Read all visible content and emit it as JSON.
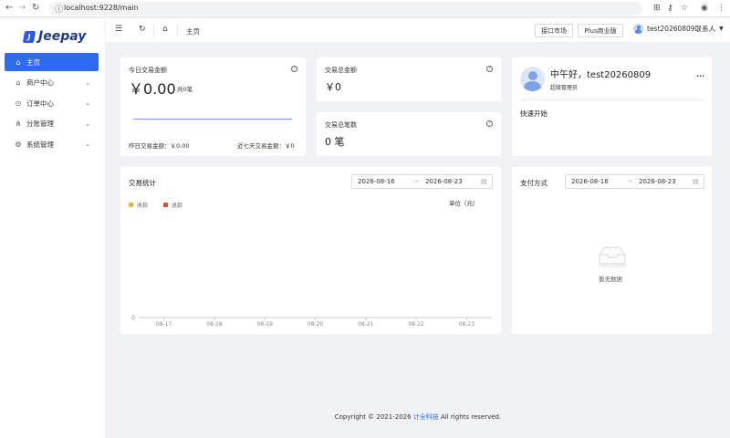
{
  "browser": {
    "url": "localhost:9228/main"
  },
  "brand": {
    "logo_letter": "J",
    "name": "Jeepay",
    "color": "#2f59d9"
  },
  "sidebar": {
    "items": [
      {
        "label": "主页",
        "icon": "home-icon",
        "active": true
      },
      {
        "label": "商户中心",
        "icon": "merchant-icon"
      },
      {
        "label": "订单中心",
        "icon": "order-icon"
      },
      {
        "label": "分账管理",
        "icon": "split-icon"
      },
      {
        "label": "系统管理",
        "icon": "settings-icon"
      }
    ]
  },
  "header": {
    "breadcrumb": "主页",
    "api_market": "接口市场",
    "plus": "Plus商业版",
    "username": "test20260809联系人"
  },
  "today": {
    "label": "今日交易金额",
    "value": "￥0.00",
    "count": "共0笔",
    "yesterday": "昨日交易金额：￥0.00",
    "week": "近七天交易金额：￥0"
  },
  "total_amount": {
    "label": "交易总金额",
    "value": "￥0"
  },
  "total_count": {
    "label": "交易总笔数",
    "value": "0 笔"
  },
  "profile": {
    "greeting": "中午好，test20260809",
    "role": "超级管理员",
    "more": "···",
    "quick_start": "快速开始"
  },
  "stats": {
    "title": "交易统计",
    "date_start": "2026-08-16",
    "date_end": "2026-08-23",
    "unit": "单位（元）",
    "legend_income": "收款",
    "legend_refund": "退款",
    "income_color": "#f0b429",
    "refund_color": "#e8472b"
  },
  "payment": {
    "title": "支付方式",
    "date_start": "2026-08-16",
    "date_end": "2026-08-23",
    "empty": "暂无数据"
  },
  "footer": {
    "prefix": "Copyright © 2021-2026 ",
    "company": "计全科技",
    "suffix": " All rights reserved."
  },
  "chart_data": {
    "type": "line",
    "title": "交易统计",
    "ylabel": "单位（元）",
    "categories": [
      "08-17",
      "08-18",
      "08-19",
      "08-20",
      "08-21",
      "08-22",
      "08-23"
    ],
    "y_ticks": [
      "0"
    ],
    "series": [
      {
        "name": "收款",
        "values": [
          0,
          0,
          0,
          0,
          0,
          0,
          0
        ]
      },
      {
        "name": "退款",
        "values": [
          0,
          0,
          0,
          0,
          0,
          0,
          0
        ]
      }
    ],
    "ylim": [
      0,
      0
    ],
    "legend": "top-left",
    "grid": false
  }
}
